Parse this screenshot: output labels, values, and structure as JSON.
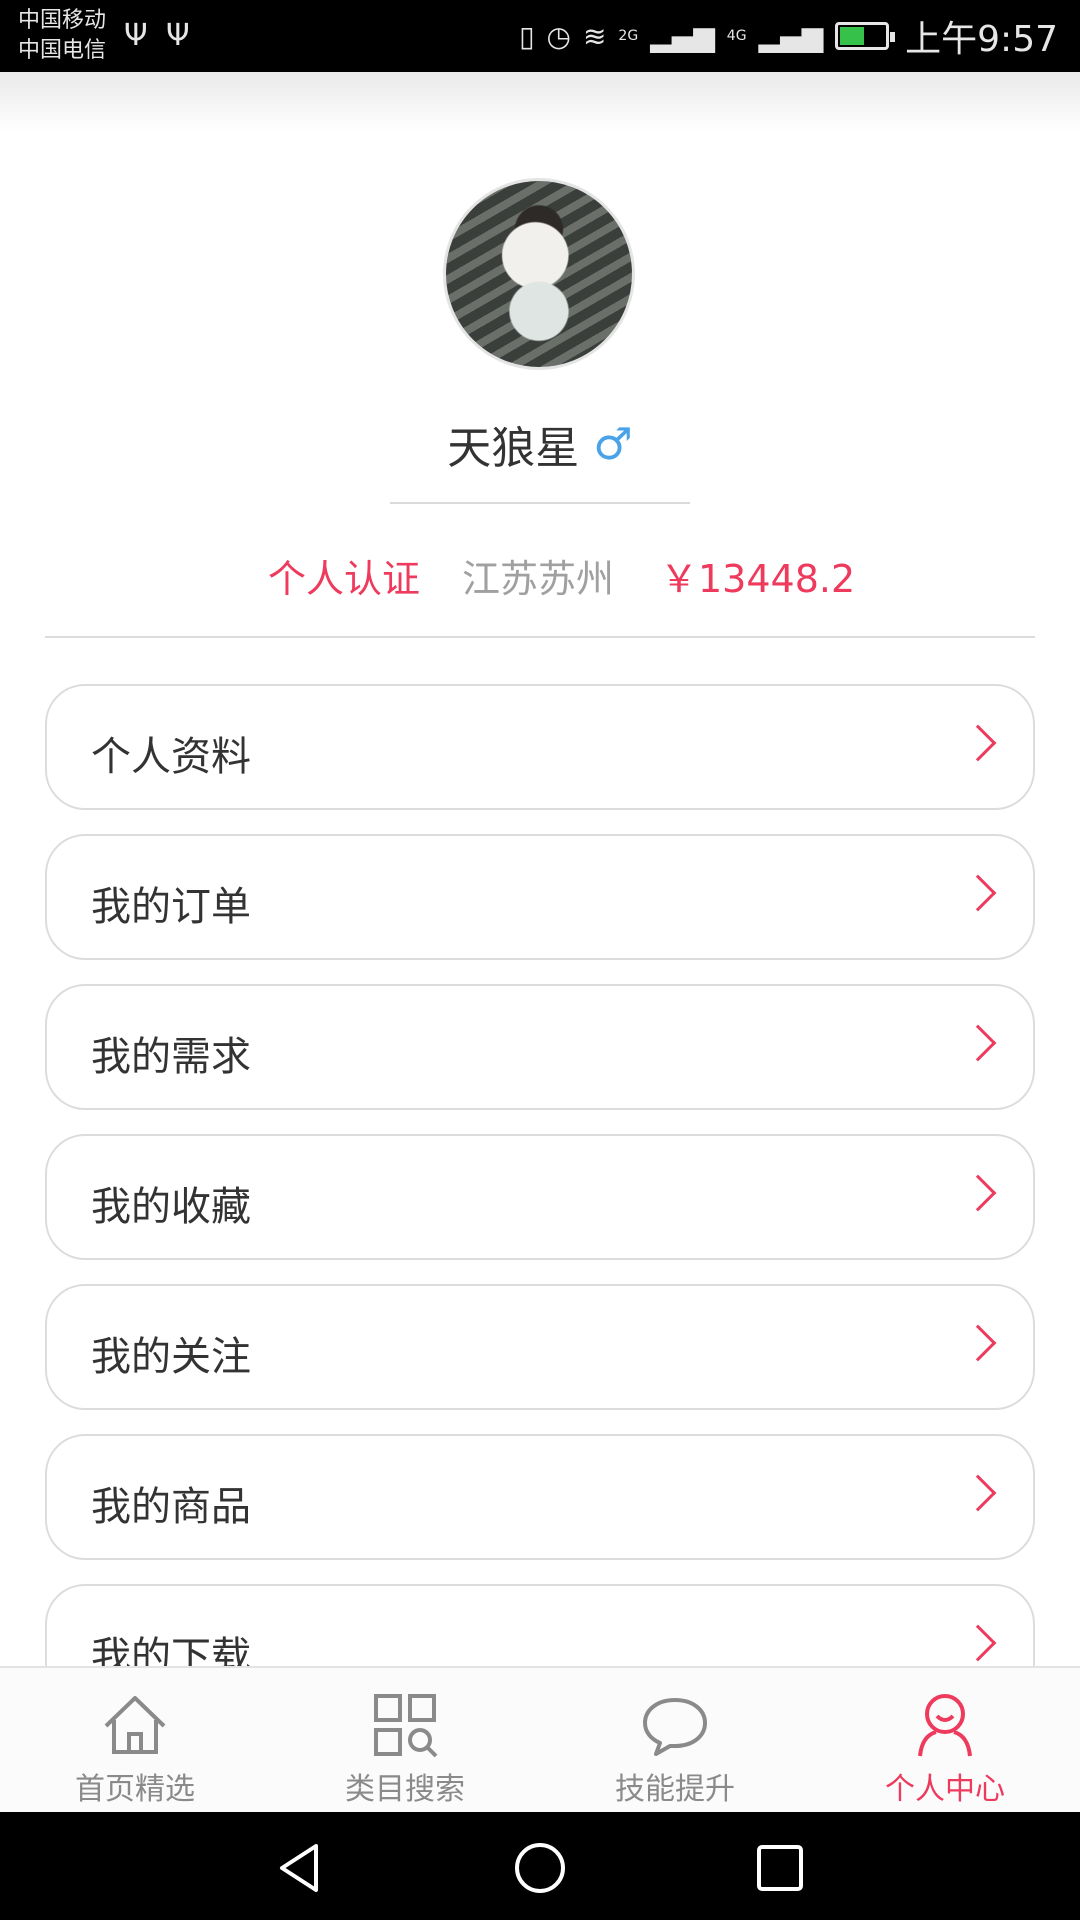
{
  "status_bar": {
    "carrier_1": "中国移动",
    "carrier_2": "中国电信",
    "time": "上午9:57",
    "network_1": "2G",
    "network_2": "4G"
  },
  "profile": {
    "nickname": "天狼星",
    "gender_symbol": "♂",
    "verification": "个人认证",
    "location": "江苏苏州",
    "balance": "￥13448.2"
  },
  "menu": {
    "items": [
      {
        "label": "个人资料"
      },
      {
        "label": "我的订单"
      },
      {
        "label": "我的需求"
      },
      {
        "label": "我的收藏"
      },
      {
        "label": "我的关注"
      },
      {
        "label": "我的商品"
      },
      {
        "label": "我的下载"
      }
    ]
  },
  "tabs": [
    {
      "label": "首页精选",
      "icon": "home-icon"
    },
    {
      "label": "类目搜索",
      "icon": "category-search-icon"
    },
    {
      "label": "技能提升",
      "icon": "chat-bubble-icon"
    },
    {
      "label": "个人中心",
      "icon": "person-icon",
      "active": true
    }
  ],
  "colors": {
    "accent": "#ee3a5c",
    "gender": "#4aa3e8",
    "muted": "#a0a0a0"
  }
}
